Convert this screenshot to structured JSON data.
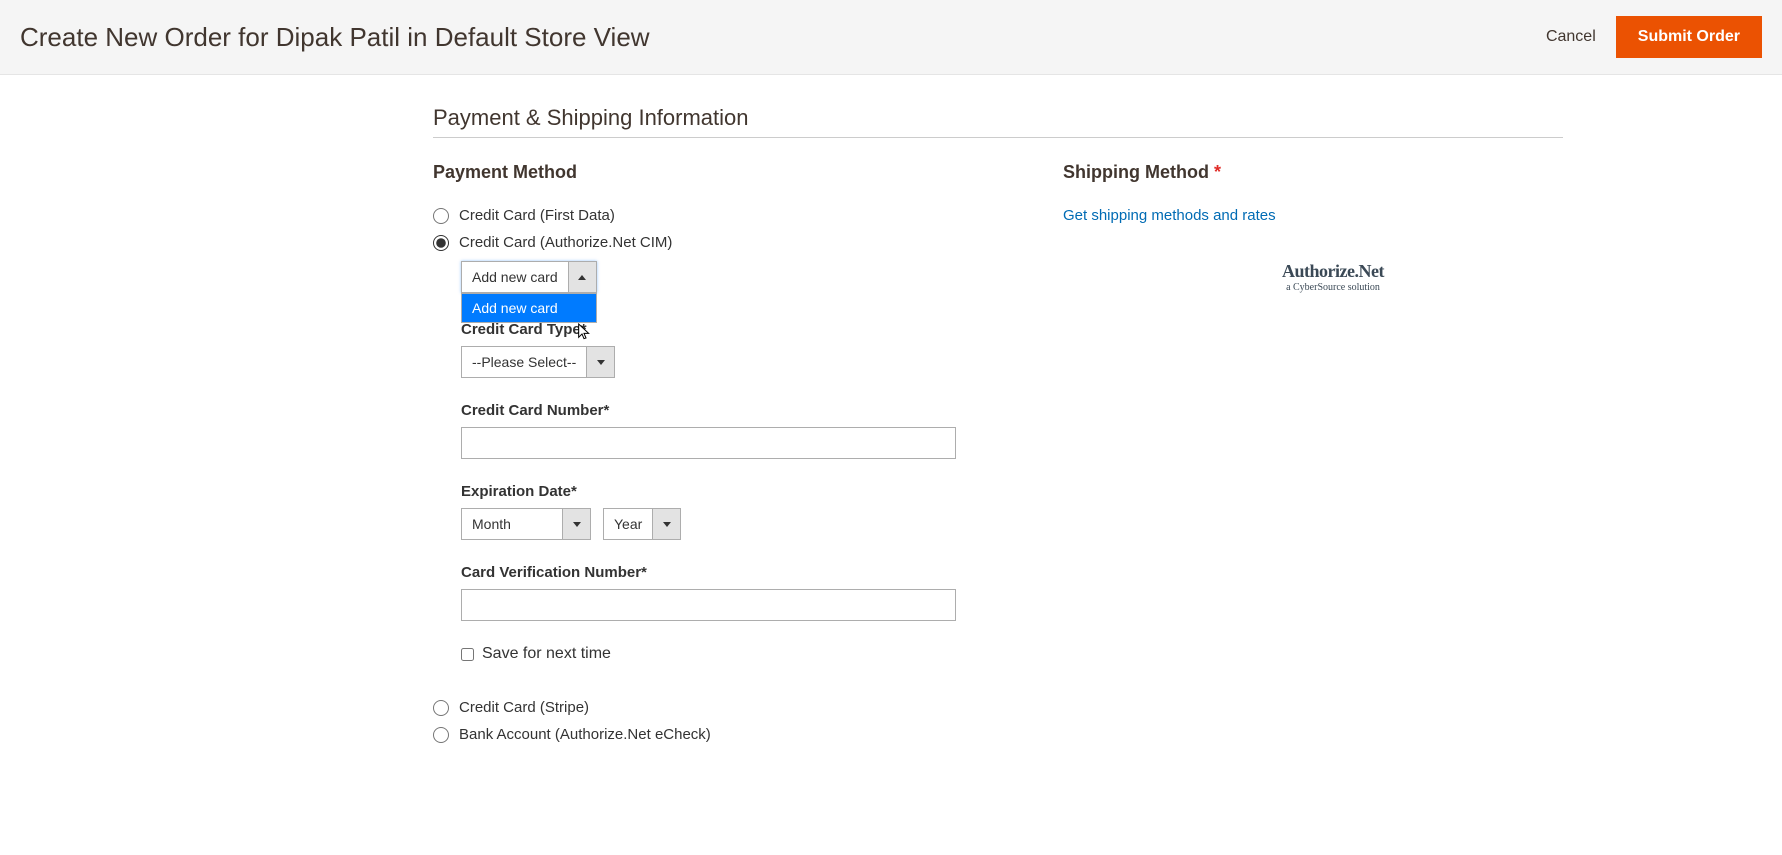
{
  "header": {
    "title": "Create New Order for Dipak Patil in Default Store View",
    "cancel": "Cancel",
    "submit": "Submit Order"
  },
  "section_title": "Payment & Shipping Information",
  "payment": {
    "title": "Payment Method",
    "methods": [
      {
        "label": "Credit Card (First Data)",
        "checked": false
      },
      {
        "label": "Credit Card (Authorize.Net CIM)",
        "checked": true
      },
      {
        "label": "Credit Card (Stripe)",
        "checked": false
      },
      {
        "label": "Bank Account (Authorize.Net eCheck)",
        "checked": false
      }
    ],
    "card_selector": {
      "selected": "Add new card",
      "option": "Add new card"
    },
    "cc_type": {
      "label": "Credit Card Type*",
      "placeholder": "--Please Select--"
    },
    "cc_number": {
      "label": "Credit Card Number*"
    },
    "exp": {
      "label": "Expiration Date*",
      "month": "Month",
      "year": "Year"
    },
    "cvv": {
      "label": "Card Verification Number*"
    },
    "save_label": "Save for next time",
    "logo": {
      "main": "Authorize.Net",
      "sub": "a CyberSource solution"
    }
  },
  "shipping": {
    "title": "Shipping Method",
    "link": "Get shipping methods and rates"
  }
}
